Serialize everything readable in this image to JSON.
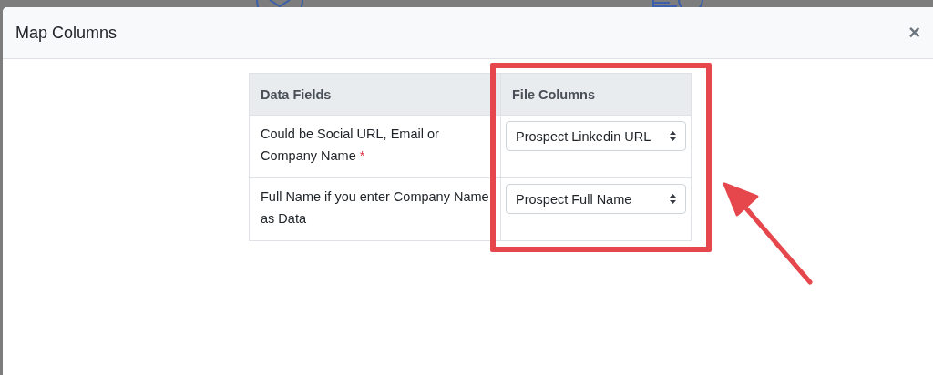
{
  "modal": {
    "title": "Map Columns",
    "close": "×"
  },
  "table": {
    "columns": [
      "Data Fields",
      "File Columns"
    ],
    "rows": [
      {
        "field": "Could be Social URL, Email or Company Name",
        "required_mark": "*",
        "file_column": "Prospect Linkedin URL"
      },
      {
        "field": "Full Name if you enter Company Name as Data",
        "file_column": "Prospect Full Name"
      }
    ]
  }
}
